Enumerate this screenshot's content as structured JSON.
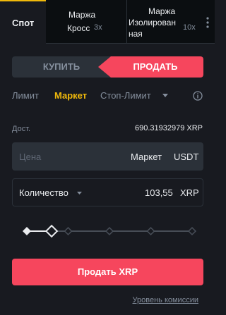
{
  "tabs": {
    "spot": "Спот",
    "cross_line1": "Маржа",
    "cross_line2": "Кросс",
    "cross_leverage": "3x",
    "isolated_line1": "Маржа",
    "isolated_line2": "Изолирован",
    "isolated_line3": "ная",
    "isolated_leverage": "10x"
  },
  "side": {
    "buy": "КУПИТЬ",
    "sell": "ПРОДАТЬ",
    "selected": "sell"
  },
  "order_types": {
    "limit": "Лимит",
    "market": "Маркет",
    "stop_limit": "Стоп-Лимит",
    "selected": "market"
  },
  "available": {
    "label": "Дост.",
    "value": "690.31932979 XRP"
  },
  "price": {
    "placeholder": "Цена",
    "value": "Маркет",
    "unit": "USDT"
  },
  "quantity": {
    "label": "Количество",
    "value": "103,55",
    "unit": "XRP"
  },
  "slider": {
    "value_fraction": 0.15,
    "ticks": [
      0,
      0.25,
      0.5,
      0.75,
      1
    ]
  },
  "sell_button": "Продать XRP",
  "fee_link": "Уровень комиссии",
  "colors": {
    "accent": "#f0b90b",
    "sell": "#f6465d",
    "background": "#181a20",
    "field": "#2b3139"
  }
}
